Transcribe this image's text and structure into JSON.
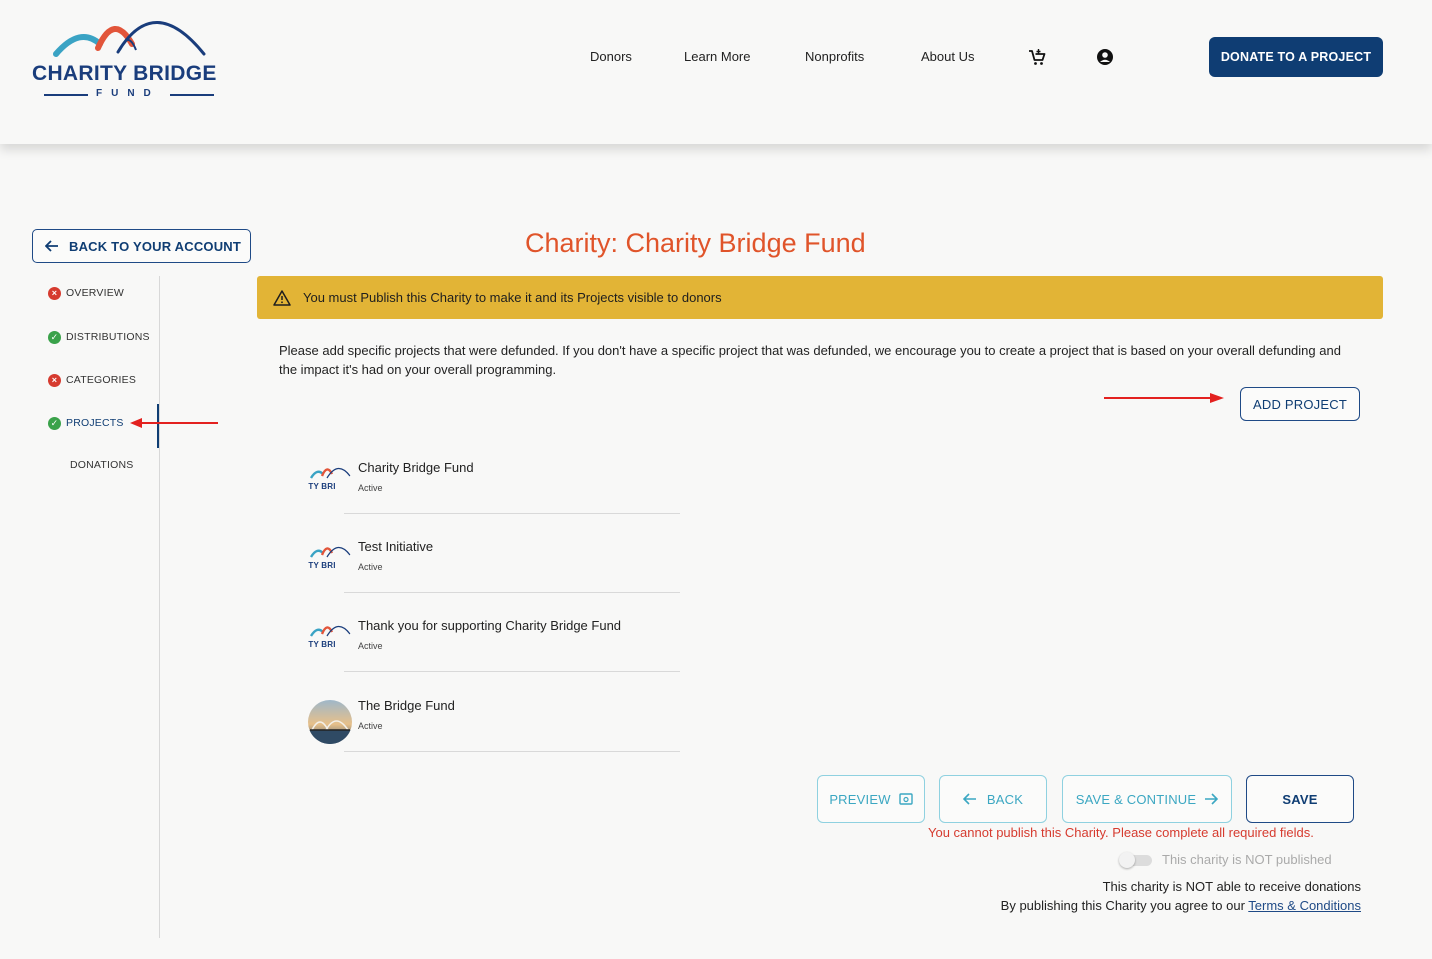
{
  "header": {
    "logo_title": "CHARITY BRIDGE",
    "logo_subtitle": "FUND",
    "nav": [
      "Donors",
      "Learn More",
      "Nonprofits",
      "About Us"
    ],
    "cart_icon": "cart-icon",
    "account_icon": "account-icon",
    "donate_label": "DONATE TO A PROJECT"
  },
  "sidebar": {
    "back_label": "BACK TO YOUR ACCOUNT",
    "items": [
      {
        "label": "OVERVIEW",
        "status": "error"
      },
      {
        "label": "DISTRIBUTIONS",
        "status": "ok"
      },
      {
        "label": "CATEGORIES",
        "status": "error"
      },
      {
        "label": "PROJECTS",
        "status": "ok",
        "active": true
      },
      {
        "label": "DONATIONS",
        "status": "none"
      }
    ]
  },
  "main": {
    "title": "Charity: Charity Bridge Fund",
    "alert": "You must Publish this Charity to make it and its Projects visible to donors",
    "intro": "Please add specific projects that were defunded. If you don't have a specific project that was defunded, we encourage you to create a project that is based on your overall defunding and the impact it's had on your overall programming.",
    "add_project_label": "ADD PROJECT",
    "projects": [
      {
        "name": "Charity Bridge Fund",
        "status": "Active",
        "thumb_text": "RITY BRI"
      },
      {
        "name": "Test Initiative",
        "status": "Active",
        "thumb_text": "RITY BRI"
      },
      {
        "name": "Thank you for supporting Charity Bridge Fund",
        "status": "Active",
        "thumb_text": "RITY BRI"
      },
      {
        "name": "The Bridge Fund",
        "status": "Active"
      }
    ]
  },
  "actions": {
    "preview_label": "PREVIEW",
    "back_label": "BACK",
    "save_continue_label": "SAVE & CONTINUE",
    "save_label": "SAVE",
    "error_message": "You cannot publish this Charity. Please complete all required fields.",
    "publish_toggle_label": "This charity is NOT published",
    "donation_note": "This charity is NOT able to receive donations",
    "terms_prefix": "By publishing this Charity you agree to our ",
    "terms_link": "Terms & Conditions"
  },
  "colors": {
    "brand_navy": "#0f3d73",
    "title_orange": "#e0542a",
    "alert_yellow": "#e2b436",
    "error_red": "#d63b2f",
    "success_green": "#3aa24a",
    "light_teal": "#3ba7c2"
  }
}
